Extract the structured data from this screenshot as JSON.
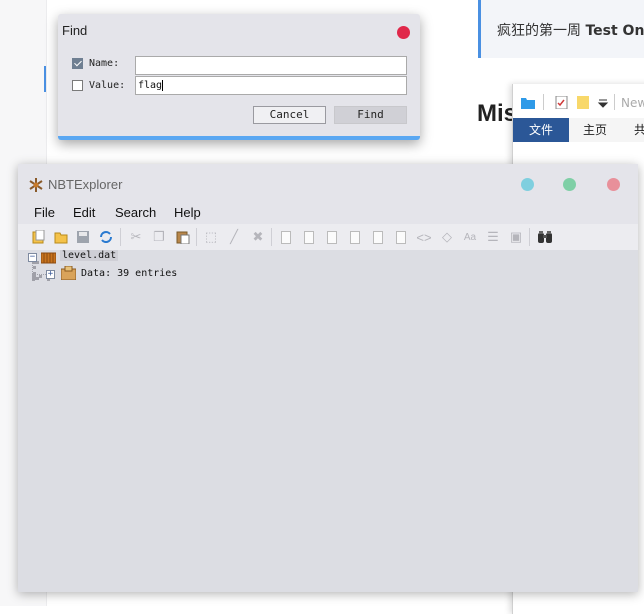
{
  "background": {
    "banner": {
      "text": "疯狂的第一周 ",
      "bold": "Test On"
    },
    "heading": "Mis",
    "explorer": {
      "new_label": "New",
      "ribbon_tabs": [
        {
          "label": "文件",
          "active": true
        },
        {
          "label": "主页",
          "active": false
        },
        {
          "label": "共",
          "active": false
        }
      ]
    }
  },
  "find_dialog": {
    "title": "Find",
    "name": {
      "label": "Name:",
      "checked": true,
      "value": ""
    },
    "value": {
      "label": "Value:",
      "checked": false,
      "value": "flag"
    },
    "cancel_label": "Cancel",
    "find_label": "Find",
    "accent_color": "#5aa7f2",
    "close_color": "#e0284a"
  },
  "nbt": {
    "title": "NBTExplorer",
    "window_buttons": {
      "minimize": "#7fcfdf",
      "maximize": "#7fcfa6",
      "close": "#e8909a"
    },
    "menu": [
      "File",
      "Edit",
      "Search",
      "Help"
    ],
    "toolbar_icons": [
      "open-file-icon",
      "open-folder-icon",
      "save-icon",
      "refresh-icon",
      "cut-icon",
      "copy-icon",
      "paste-icon",
      "rename-icon",
      "edit-icon",
      "delete-icon",
      "add-byte-icon",
      "add-short-icon",
      "add-int-icon",
      "add-long-icon",
      "add-float-icon",
      "add-double-icon",
      "add-byte-array-icon",
      "add-int-array-icon",
      "add-string-icon",
      "add-list-icon",
      "add-compound-icon",
      "find-icon"
    ],
    "tree": {
      "root": {
        "label": "level.dat"
      },
      "child": {
        "label": "Data: 39 entries"
      }
    }
  }
}
